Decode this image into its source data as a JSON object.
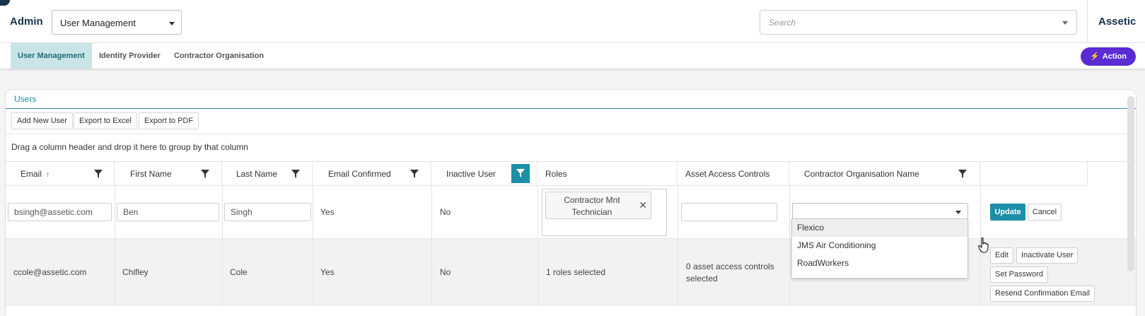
{
  "header": {
    "title": "Admin",
    "module_select": "User Management",
    "search_placeholder": "Search",
    "brand": "Assetic"
  },
  "nav": {
    "tabs": [
      {
        "label": "User Management",
        "active": true
      },
      {
        "label": "Identity Provider",
        "active": false
      },
      {
        "label": "Contractor Organisation",
        "active": false
      }
    ],
    "action_label": "Action"
  },
  "card": {
    "title": "Users",
    "toolbar": {
      "add": "Add New User",
      "excel": "Export to Excel",
      "pdf": "Export to PDF"
    },
    "group_hint": "Drag a column header and drop it here to group by that column"
  },
  "grid": {
    "columns": [
      "Email",
      "First Name",
      "Last Name",
      "Email Confirmed",
      "Inactive User",
      "Roles",
      "Asset Access Controls",
      "Contractor Organisation Name"
    ],
    "sort_icon": "↑",
    "edit_row": {
      "email": "bsingh@assetic.com",
      "first_name": "Ben",
      "last_name": "Singh",
      "email_confirmed": "Yes",
      "inactive": "No",
      "role_chip": "Contractor Mnt Technician",
      "asset_access": "",
      "contractor_org": "",
      "update": "Update",
      "cancel": "Cancel"
    },
    "row2": {
      "email": "ccole@assetic.com",
      "first_name": "Chifley",
      "last_name": "Cole",
      "email_confirmed": "Yes",
      "inactive": "No",
      "roles": "1 roles selected",
      "asset_access": "0 asset access controls selected",
      "buttons": {
        "edit": "Edit",
        "inactivate": "Inactivate User",
        "set_password": "Set Password",
        "resend": "Resend Confirmation Email"
      }
    }
  },
  "dropdown_options": [
    "Flexico",
    "JMS Air Conditioning",
    "RoadWorkers"
  ],
  "colors": {
    "accent": "#1c8fa8",
    "brand_navy": "#17324d",
    "action_purple": "#5b2bd4",
    "active_tab_bg": "#c9e4e6"
  }
}
